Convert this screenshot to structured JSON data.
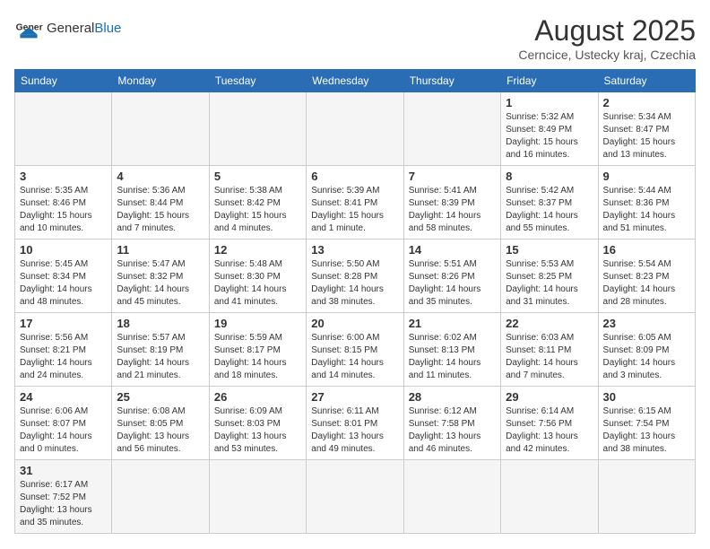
{
  "header": {
    "logo_general": "General",
    "logo_blue": "Blue",
    "month_title": "August 2025",
    "location": "Cerncice, Ustecky kraj, Czechia"
  },
  "days_of_week": [
    "Sunday",
    "Monday",
    "Tuesday",
    "Wednesday",
    "Thursday",
    "Friday",
    "Saturday"
  ],
  "weeks": [
    [
      {
        "day": "",
        "info": ""
      },
      {
        "day": "",
        "info": ""
      },
      {
        "day": "",
        "info": ""
      },
      {
        "day": "",
        "info": ""
      },
      {
        "day": "",
        "info": ""
      },
      {
        "day": "1",
        "info": "Sunrise: 5:32 AM\nSunset: 8:49 PM\nDaylight: 15 hours and 16 minutes."
      },
      {
        "day": "2",
        "info": "Sunrise: 5:34 AM\nSunset: 8:47 PM\nDaylight: 15 hours and 13 minutes."
      }
    ],
    [
      {
        "day": "3",
        "info": "Sunrise: 5:35 AM\nSunset: 8:46 PM\nDaylight: 15 hours and 10 minutes."
      },
      {
        "day": "4",
        "info": "Sunrise: 5:36 AM\nSunset: 8:44 PM\nDaylight: 15 hours and 7 minutes."
      },
      {
        "day": "5",
        "info": "Sunrise: 5:38 AM\nSunset: 8:42 PM\nDaylight: 15 hours and 4 minutes."
      },
      {
        "day": "6",
        "info": "Sunrise: 5:39 AM\nSunset: 8:41 PM\nDaylight: 15 hours and 1 minute."
      },
      {
        "day": "7",
        "info": "Sunrise: 5:41 AM\nSunset: 8:39 PM\nDaylight: 14 hours and 58 minutes."
      },
      {
        "day": "8",
        "info": "Sunrise: 5:42 AM\nSunset: 8:37 PM\nDaylight: 14 hours and 55 minutes."
      },
      {
        "day": "9",
        "info": "Sunrise: 5:44 AM\nSunset: 8:36 PM\nDaylight: 14 hours and 51 minutes."
      }
    ],
    [
      {
        "day": "10",
        "info": "Sunrise: 5:45 AM\nSunset: 8:34 PM\nDaylight: 14 hours and 48 minutes."
      },
      {
        "day": "11",
        "info": "Sunrise: 5:47 AM\nSunset: 8:32 PM\nDaylight: 14 hours and 45 minutes."
      },
      {
        "day": "12",
        "info": "Sunrise: 5:48 AM\nSunset: 8:30 PM\nDaylight: 14 hours and 41 minutes."
      },
      {
        "day": "13",
        "info": "Sunrise: 5:50 AM\nSunset: 8:28 PM\nDaylight: 14 hours and 38 minutes."
      },
      {
        "day": "14",
        "info": "Sunrise: 5:51 AM\nSunset: 8:26 PM\nDaylight: 14 hours and 35 minutes."
      },
      {
        "day": "15",
        "info": "Sunrise: 5:53 AM\nSunset: 8:25 PM\nDaylight: 14 hours and 31 minutes."
      },
      {
        "day": "16",
        "info": "Sunrise: 5:54 AM\nSunset: 8:23 PM\nDaylight: 14 hours and 28 minutes."
      }
    ],
    [
      {
        "day": "17",
        "info": "Sunrise: 5:56 AM\nSunset: 8:21 PM\nDaylight: 14 hours and 24 minutes."
      },
      {
        "day": "18",
        "info": "Sunrise: 5:57 AM\nSunset: 8:19 PM\nDaylight: 14 hours and 21 minutes."
      },
      {
        "day": "19",
        "info": "Sunrise: 5:59 AM\nSunset: 8:17 PM\nDaylight: 14 hours and 18 minutes."
      },
      {
        "day": "20",
        "info": "Sunrise: 6:00 AM\nSunset: 8:15 PM\nDaylight: 14 hours and 14 minutes."
      },
      {
        "day": "21",
        "info": "Sunrise: 6:02 AM\nSunset: 8:13 PM\nDaylight: 14 hours and 11 minutes."
      },
      {
        "day": "22",
        "info": "Sunrise: 6:03 AM\nSunset: 8:11 PM\nDaylight: 14 hours and 7 minutes."
      },
      {
        "day": "23",
        "info": "Sunrise: 6:05 AM\nSunset: 8:09 PM\nDaylight: 14 hours and 3 minutes."
      }
    ],
    [
      {
        "day": "24",
        "info": "Sunrise: 6:06 AM\nSunset: 8:07 PM\nDaylight: 14 hours and 0 minutes."
      },
      {
        "day": "25",
        "info": "Sunrise: 6:08 AM\nSunset: 8:05 PM\nDaylight: 13 hours and 56 minutes."
      },
      {
        "day": "26",
        "info": "Sunrise: 6:09 AM\nSunset: 8:03 PM\nDaylight: 13 hours and 53 minutes."
      },
      {
        "day": "27",
        "info": "Sunrise: 6:11 AM\nSunset: 8:01 PM\nDaylight: 13 hours and 49 minutes."
      },
      {
        "day": "28",
        "info": "Sunrise: 6:12 AM\nSunset: 7:58 PM\nDaylight: 13 hours and 46 minutes."
      },
      {
        "day": "29",
        "info": "Sunrise: 6:14 AM\nSunset: 7:56 PM\nDaylight: 13 hours and 42 minutes."
      },
      {
        "day": "30",
        "info": "Sunrise: 6:15 AM\nSunset: 7:54 PM\nDaylight: 13 hours and 38 minutes."
      }
    ],
    [
      {
        "day": "31",
        "info": "Sunrise: 6:17 AM\nSunset: 7:52 PM\nDaylight: 13 hours and 35 minutes."
      },
      {
        "day": "",
        "info": ""
      },
      {
        "day": "",
        "info": ""
      },
      {
        "day": "",
        "info": ""
      },
      {
        "day": "",
        "info": ""
      },
      {
        "day": "",
        "info": ""
      },
      {
        "day": "",
        "info": ""
      }
    ]
  ]
}
